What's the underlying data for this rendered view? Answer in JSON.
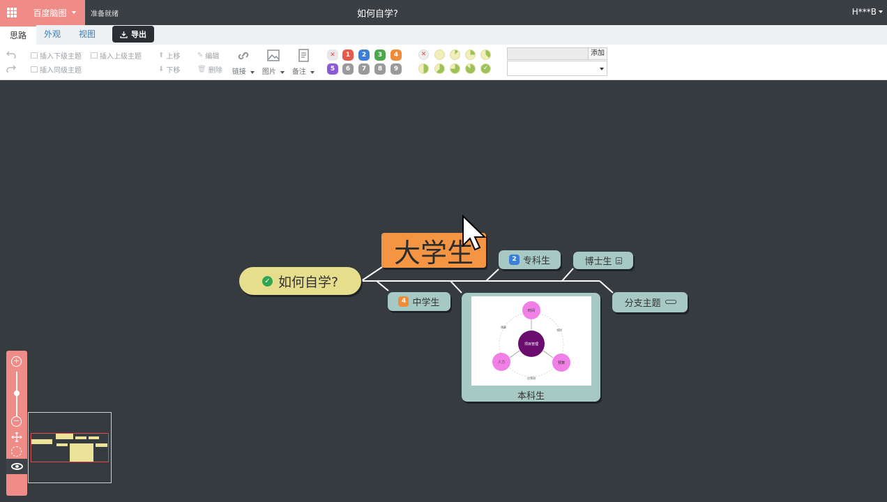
{
  "topbar": {
    "brand": "百度脑图",
    "status": "准备就绪",
    "title": "如何自学?",
    "user": "H***B"
  },
  "tabs": [
    {
      "label": "思路",
      "active": true
    },
    {
      "label": "外观",
      "active": false
    },
    {
      "label": "视图",
      "active": false
    }
  ],
  "export_label": "导出",
  "toolbar": {
    "insert_child": "插入下级主题",
    "insert_parent": "插入上级主题",
    "insert_sibling": "插入同级主题",
    "move_up": "上移",
    "move_down": "下移",
    "edit": "编辑",
    "delete": "删除",
    "link": "链接",
    "image": "图片",
    "note": "备注",
    "priorities": [
      "1",
      "2",
      "3",
      "4",
      "5",
      "6",
      "7",
      "8",
      "9"
    ],
    "resource_add": "添加"
  },
  "colors": {
    "accent": "#f08c87",
    "canvas": "#363b40",
    "root_node": "#e6dd8d",
    "main_node": "#f39543",
    "sub_node": "#a7c9c3"
  },
  "mindmap": {
    "root": "如何自学?",
    "main": "大学生",
    "zhuanke": {
      "label": "专科生",
      "priority": "2"
    },
    "boshi": {
      "label": "博士生"
    },
    "zhongxue": {
      "label": "中学生",
      "priority": "4"
    },
    "fenzhi": {
      "label": "分支主题"
    },
    "benke": {
      "label": "本科生"
    }
  },
  "diagram": {
    "center": "项目管理",
    "top": "时间",
    "left": "人力",
    "right": "预算",
    "label_tl": "预算",
    "label_tr": "领时",
    "label_bottom": "应预测"
  }
}
